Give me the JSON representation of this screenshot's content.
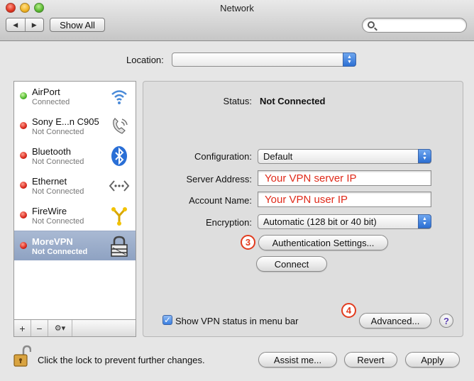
{
  "window": {
    "title": "Network"
  },
  "toolbar": {
    "back_glyph": "◀",
    "forward_glyph": "▶",
    "show_all_label": "Show All",
    "search_value": ""
  },
  "location": {
    "label": "Location:",
    "value": ""
  },
  "services": [
    {
      "name": "AirPort",
      "status": "Connected",
      "status_color": "green",
      "icon": "wifi-icon",
      "selected": false
    },
    {
      "name": "Sony E...n C905",
      "status": "Not Connected",
      "status_color": "red",
      "icon": "phone-modem-icon",
      "selected": false
    },
    {
      "name": "Bluetooth",
      "status": "Not Connected",
      "status_color": "red",
      "icon": "bluetooth-icon",
      "selected": false
    },
    {
      "name": "Ethernet",
      "status": "Not Connected",
      "status_color": "red",
      "icon": "ethernet-icon",
      "selected": false
    },
    {
      "name": "FireWire",
      "status": "Not Connected",
      "status_color": "red",
      "icon": "firewire-icon",
      "selected": false
    },
    {
      "name": "MoreVPN",
      "status": "Not Connected",
      "status_color": "red",
      "icon": "vpn-lock-icon",
      "selected": true
    }
  ],
  "list_actions": {
    "add": "+",
    "remove": "−",
    "gear": "⚙▾"
  },
  "detail": {
    "status_label": "Status:",
    "status_value": "Not Connected",
    "configuration_label": "Configuration:",
    "configuration_value": "Default",
    "server_address_label": "Server Address:",
    "server_address_value": "Your VPN server IP",
    "account_name_label": "Account Name:",
    "account_name_value": "Your VPN user IP",
    "encryption_label": "Encryption:",
    "encryption_value": "Automatic (128 bit or 40 bit)",
    "auth_settings_label": "Authentication Settings...",
    "connect_label": "Connect",
    "show_vpn_status_label": "Show VPN status in menu bar",
    "show_vpn_status_checked": true,
    "advanced_label": "Advanced...",
    "help_label": "?",
    "step_badges": [
      "3",
      "4"
    ]
  },
  "footer": {
    "lock_text": "Click the lock to prevent further changes.",
    "assist_label": "Assist me...",
    "revert_label": "Revert",
    "apply_label": "Apply"
  },
  "colors": {
    "selection": "#8ea2c2",
    "annotation_red": "#e02a1a",
    "popup_blue": "#2c6fd3"
  }
}
